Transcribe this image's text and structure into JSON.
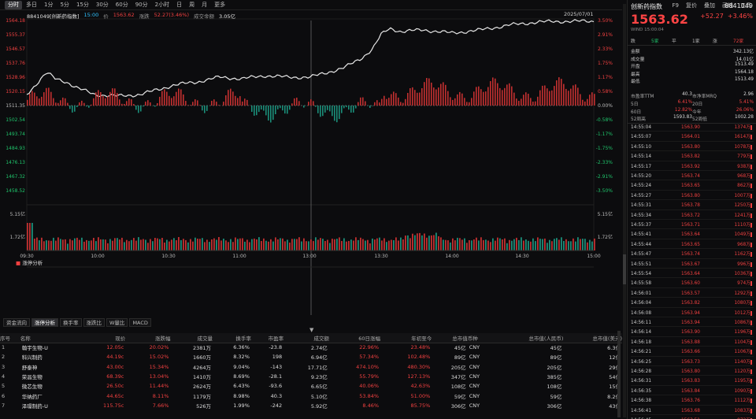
{
  "toolbar": {
    "periods": [
      "分时",
      "多日",
      "1分",
      "5分",
      "15分",
      "30分",
      "60分",
      "90分",
      "2小时",
      "日",
      "周",
      "月",
      "更多"
    ],
    "right": [
      "F9",
      "复价",
      "叠加",
      "画线",
      "工具"
    ]
  },
  "info": {
    "name": "8841049[创新药指数]",
    "time": "15:00",
    "price_label": "价",
    "price": "1563.62",
    "chg_label": "涨跌",
    "chg": "52.27(3.46%)",
    "amt_label": "成交金额",
    "amt": "3.05亿"
  },
  "date": "2025/07/01",
  "axis": {
    "left": [
      "1564.18",
      "1555.37",
      "1546.57",
      "1537.76",
      "1528.96",
      "1520.15",
      "1511.35",
      "1502.54",
      "1493.74",
      "1484.93",
      "1476.13",
      "1467.32",
      "1458.52"
    ],
    "right": [
      "3.50%",
      "2.91%",
      "2.33%",
      "1.75%",
      "1.17%",
      "0.58%",
      "0.00%",
      "-0.58%",
      "-1.17%",
      "-1.75%",
      "-2.33%",
      "-2.91%",
      "-3.50%"
    ],
    "vol": [
      "5.15亿",
      "1.72亿"
    ],
    "times": [
      "09:30",
      "10:00",
      "10:30",
      "11:00",
      "11:30",
      "13:00",
      "13:30",
      "14:00",
      "14:30",
      "15:00"
    ]
  },
  "sect": "涨停分析",
  "tabs": [
    "资金流向",
    "涨停分析",
    "换手率",
    "涨跌比",
    "W量比",
    "MACD"
  ],
  "table": {
    "headers": [
      "序号",
      "名称",
      "现价",
      "涨跌幅",
      "成交量",
      "换手率",
      "市盈率",
      "成交额",
      "60日涨幅",
      "年初至今",
      "总市值",
      "币种",
      "总市值(人民币)",
      "总市值(美元)"
    ],
    "rows": [
      [
        "1",
        "翰宇生物-U",
        "12.05c",
        "20.02%",
        "2381万",
        "6.36%",
        "-23.8",
        "2.74亿",
        "22.96%",
        "23.48%",
        "45亿",
        "CNY",
        "45亿",
        "6.3亿"
      ],
      [
        "2",
        "科兴制药",
        "44.19c",
        "15.02%",
        "1660万",
        "8.32%",
        "198",
        "6.94亿",
        "57.34%",
        "102.48%",
        "89亿",
        "CNY",
        "89亿",
        "12亿"
      ],
      [
        "3",
        "舒泰神",
        "43.00c",
        "15.34%",
        "4264万",
        "9.04%",
        "-143",
        "17.71亿",
        "474.10%",
        "480.30%",
        "205亿",
        "CNY",
        "205亿",
        "29亿"
      ],
      [
        "4",
        "荣昌生物",
        "68.39c",
        "13.04%",
        "1410万",
        "8.69%",
        "-28.1",
        "9.23亿",
        "55.79%",
        "127.13%",
        "347亿",
        "CNY",
        "385亿",
        "54亿"
      ],
      [
        "5",
        "微芯生物",
        "26.50c",
        "11.44%",
        "2624万",
        "6.43%",
        "-93.6",
        "6.65亿",
        "40.06%",
        "42.63%",
        "108亿",
        "CNY",
        "108亿",
        "15亿"
      ],
      [
        "6",
        "华纳药厂",
        "44.65c",
        "8.11%",
        "1179万",
        "8.98%",
        "40.3",
        "5.10亿",
        "53.84%",
        "51.00%",
        "59亿",
        "CNY",
        "59亿",
        "8.2亿"
      ],
      [
        "7",
        "泽璟制药-U",
        "115.75c",
        "7.66%",
        "526万",
        "1.99%",
        "-242",
        "5.92亿",
        "8.46%",
        "85.75%",
        "306亿",
        "CNY",
        "306亿",
        "43亿"
      ]
    ]
  },
  "panel": {
    "name": "创新药指数",
    "code": "8841049",
    "price": "1563.62",
    "chg": "+52.27",
    "pct": "+3.46%",
    "wind": "WIND 15:00:04",
    "breadth": [
      "跌",
      "5家",
      "平",
      "1家",
      "涨",
      "72家"
    ],
    "kv": [
      [
        "金额",
        "342.13亿"
      ],
      [
        "成交量",
        "14.01亿"
      ],
      [
        "开盘",
        "1513.49"
      ],
      [
        "最高",
        "1564.18"
      ],
      [
        "最低",
        "1513.49"
      ]
    ],
    "pe": [
      "市盈率TTM",
      "40.3",
      "市净率MRQ",
      "2.96"
    ],
    "perf": [
      [
        "5日",
        "6.41%",
        "20日",
        "5.41%"
      ],
      [
        "60日",
        "12.82%",
        "今年",
        "26.06%"
      ],
      [
        "52周高",
        "1593.83",
        "52周低",
        "1002.28"
      ]
    ],
    "ticks": [
      [
        "14:55:04",
        "1563.90",
        "1374万"
      ],
      [
        "14:55:07",
        "1564.01",
        "1614万"
      ],
      [
        "14:55:10",
        "1563.80",
        "1078万"
      ],
      [
        "14:55:14",
        "1563.82",
        "779万"
      ],
      [
        "14:55:17",
        "1563.92",
        "938万"
      ],
      [
        "14:55:20",
        "1563.74",
        "968万"
      ],
      [
        "14:55:24",
        "1563.65",
        "862万"
      ],
      [
        "14:55:27",
        "1563.80",
        "1007万"
      ],
      [
        "14:55:31",
        "1563.78",
        "1250万"
      ],
      [
        "14:55:34",
        "1563.72",
        "1241万"
      ],
      [
        "14:55:37",
        "1563.71",
        "1110万"
      ],
      [
        "14:55:41",
        "1563.64",
        "1049万"
      ],
      [
        "14:55:44",
        "1563.65",
        "968万"
      ],
      [
        "14:55:47",
        "1563.74",
        "1162万"
      ],
      [
        "14:55:51",
        "1563.67",
        "996万"
      ],
      [
        "14:55:54",
        "1563.64",
        "1036万"
      ],
      [
        "14:55:58",
        "1563.60",
        "974万"
      ],
      [
        "14:56:01",
        "1563.57",
        "1292万"
      ],
      [
        "14:56:04",
        "1563.82",
        "1080万"
      ],
      [
        "14:56:08",
        "1563.94",
        "1012万"
      ],
      [
        "14:56:11",
        "1563.94",
        "1086万"
      ],
      [
        "14:56:14",
        "1563.90",
        "1196万"
      ],
      [
        "14:56:18",
        "1563.88",
        "1104万"
      ],
      [
        "14:56:21",
        "1563.66",
        "1106万"
      ],
      [
        "14:56:25",
        "1563.73",
        "1140万"
      ],
      [
        "14:56:28",
        "1563.80",
        "1120万"
      ],
      [
        "14:56:31",
        "1563.83",
        "1195万"
      ],
      [
        "14:56:35",
        "1563.84",
        "1090万"
      ],
      [
        "14:56:38",
        "1563.76",
        "1112万"
      ],
      [
        "14:56:41",
        "1563.68",
        "1083万"
      ],
      [
        "14:56:45",
        "1563.51",
        "872万"
      ]
    ]
  }
}
